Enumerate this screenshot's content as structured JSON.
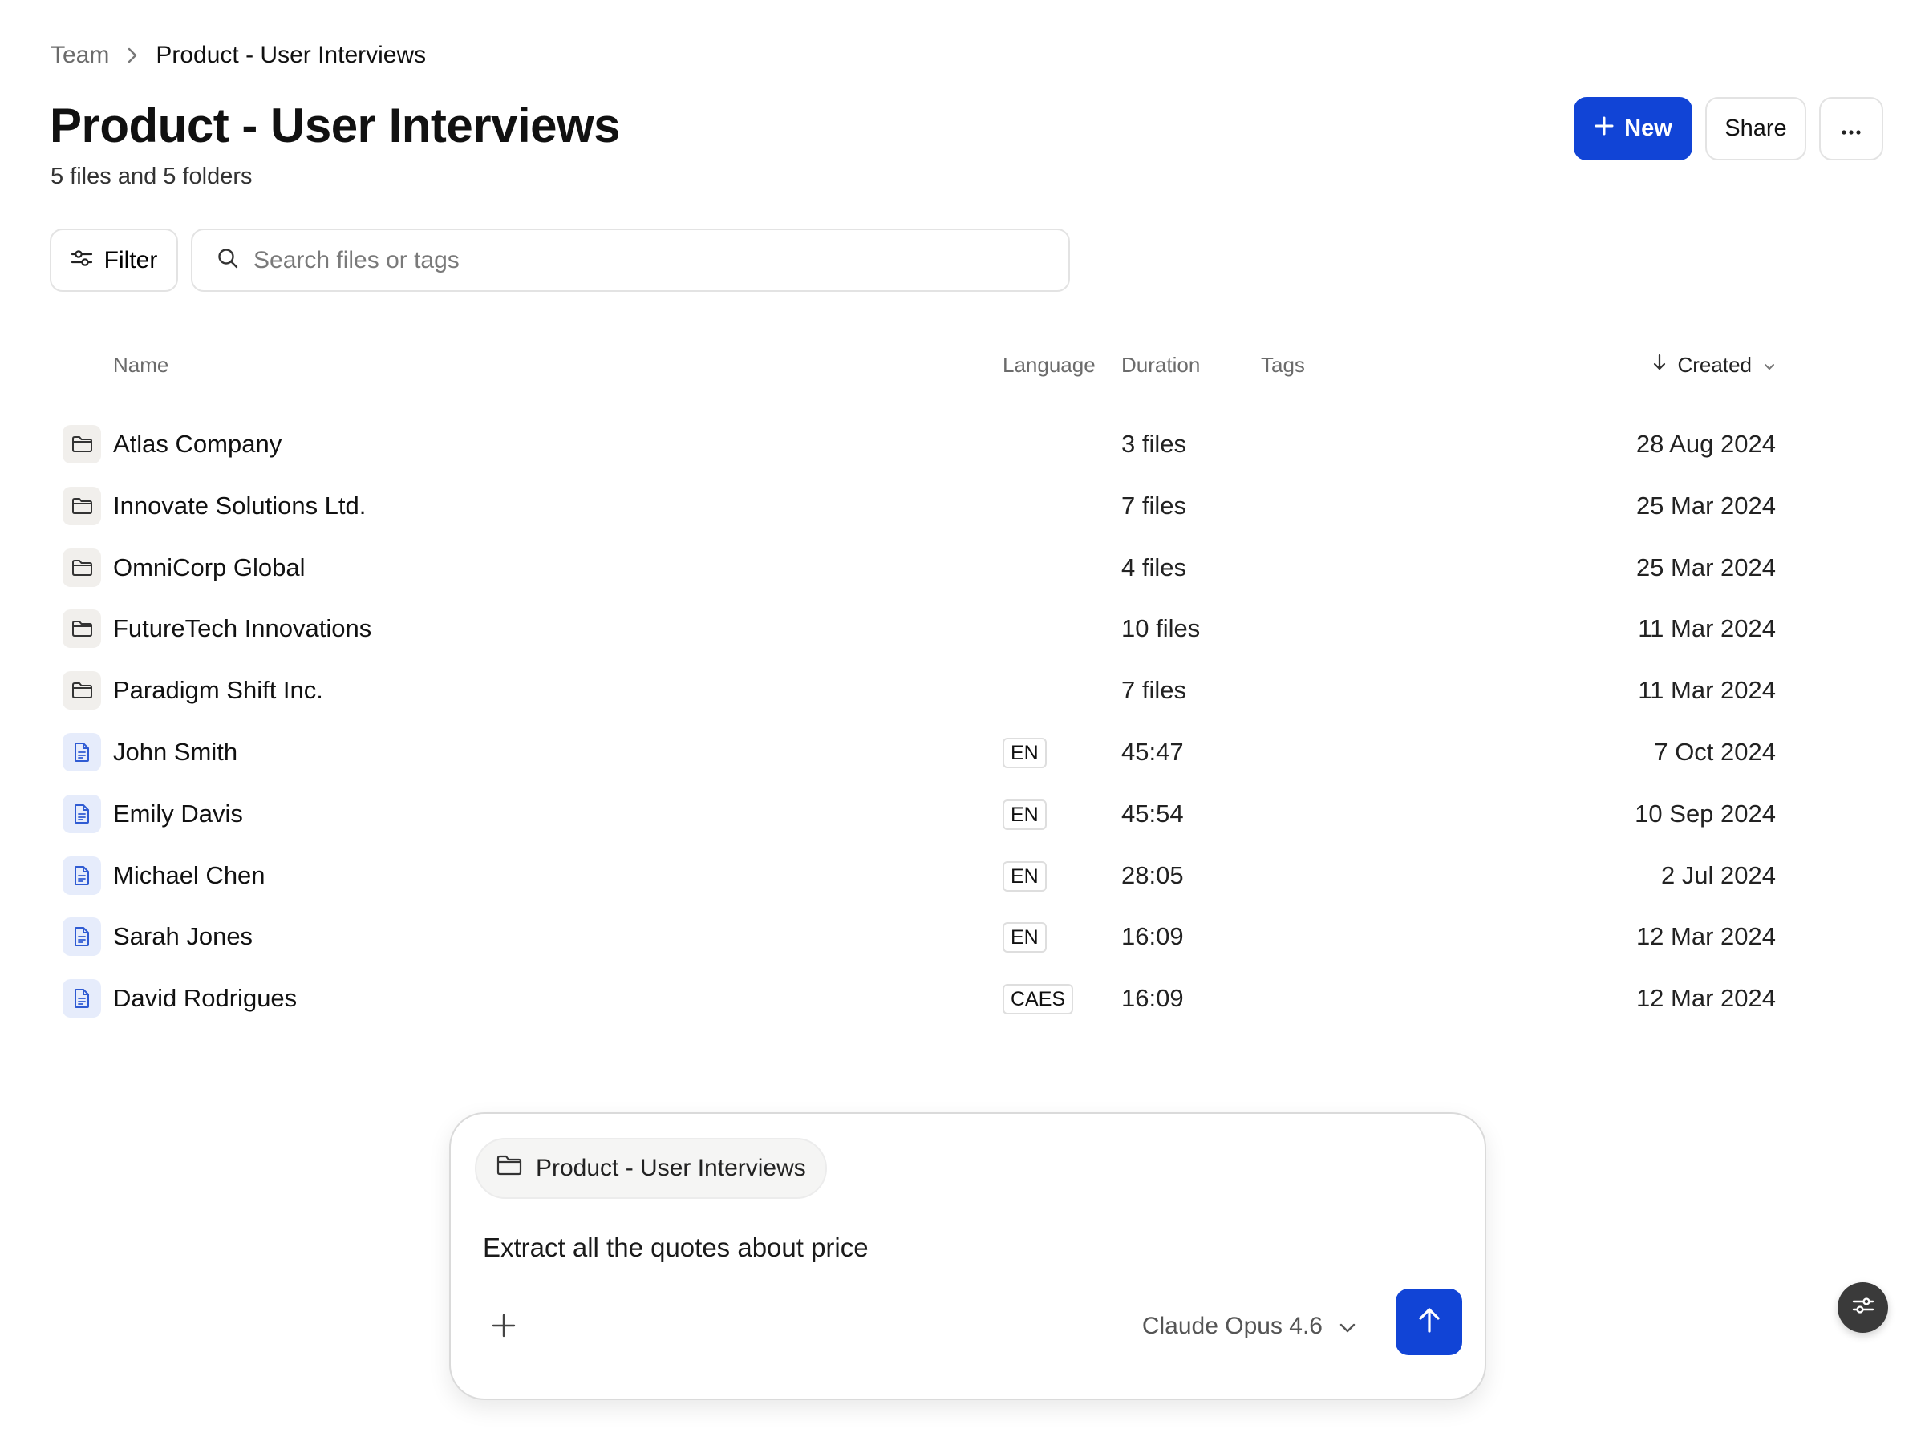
{
  "breadcrumb": {
    "parent": "Team",
    "current": "Product - User Interviews"
  },
  "header": {
    "title": "Product - User Interviews",
    "subtitle": "5 files and 5 folders",
    "new_label": "New",
    "share_label": "Share",
    "more_label": "···"
  },
  "toolbar": {
    "filter_label": "Filter",
    "search_placeholder": "Search files or tags",
    "search_value": ""
  },
  "table": {
    "columns": {
      "name": "Name",
      "language": "Language",
      "duration": "Duration",
      "tags": "Tags",
      "created": "Created"
    },
    "sort": {
      "column": "Created",
      "direction": "descending"
    },
    "rows": [
      {
        "type": "folder",
        "name": "Atlas Company",
        "language": "",
        "duration": "3 files",
        "created": "28 Aug 2024"
      },
      {
        "type": "folder",
        "name": "Innovate Solutions Ltd.",
        "language": "",
        "duration": "7 files",
        "created": "25 Mar 2024"
      },
      {
        "type": "folder",
        "name": "OmniCorp Global",
        "language": "",
        "duration": "4 files",
        "created": "25 Mar 2024"
      },
      {
        "type": "folder",
        "name": "FutureTech Innovations",
        "language": "",
        "duration": "10 files",
        "created": "11 Mar 2024"
      },
      {
        "type": "folder",
        "name": "Paradigm Shift Inc.",
        "language": "",
        "duration": "7 files",
        "created": "11 Mar 2024"
      },
      {
        "type": "file",
        "name": "John Smith",
        "language": "EN",
        "duration": "45:47",
        "created": "7 Oct 2024"
      },
      {
        "type": "file",
        "name": "Emily Davis",
        "language": "EN",
        "duration": "45:54",
        "created": "10 Sep 2024"
      },
      {
        "type": "file",
        "name": "Michael Chen",
        "language": "EN",
        "duration": "28:05",
        "created": "2 Jul 2024"
      },
      {
        "type": "file",
        "name": "Sarah Jones",
        "language": "EN",
        "duration": "16:09",
        "created": "12 Mar 2024"
      },
      {
        "type": "file",
        "name": "David Rodrigues",
        "language": "CAES",
        "duration": "16:09",
        "created": "12 Mar 2024"
      }
    ]
  },
  "composer": {
    "context_chip": "Product - User Interviews",
    "prompt": "Extract all the quotes about price",
    "model": "Claude Opus 4.6"
  },
  "colors": {
    "accent": "#1144d6",
    "folder_icon_bg": "#f1efec",
    "file_icon_bg": "#e6ecfb",
    "file_icon": "#2f5bd3"
  }
}
